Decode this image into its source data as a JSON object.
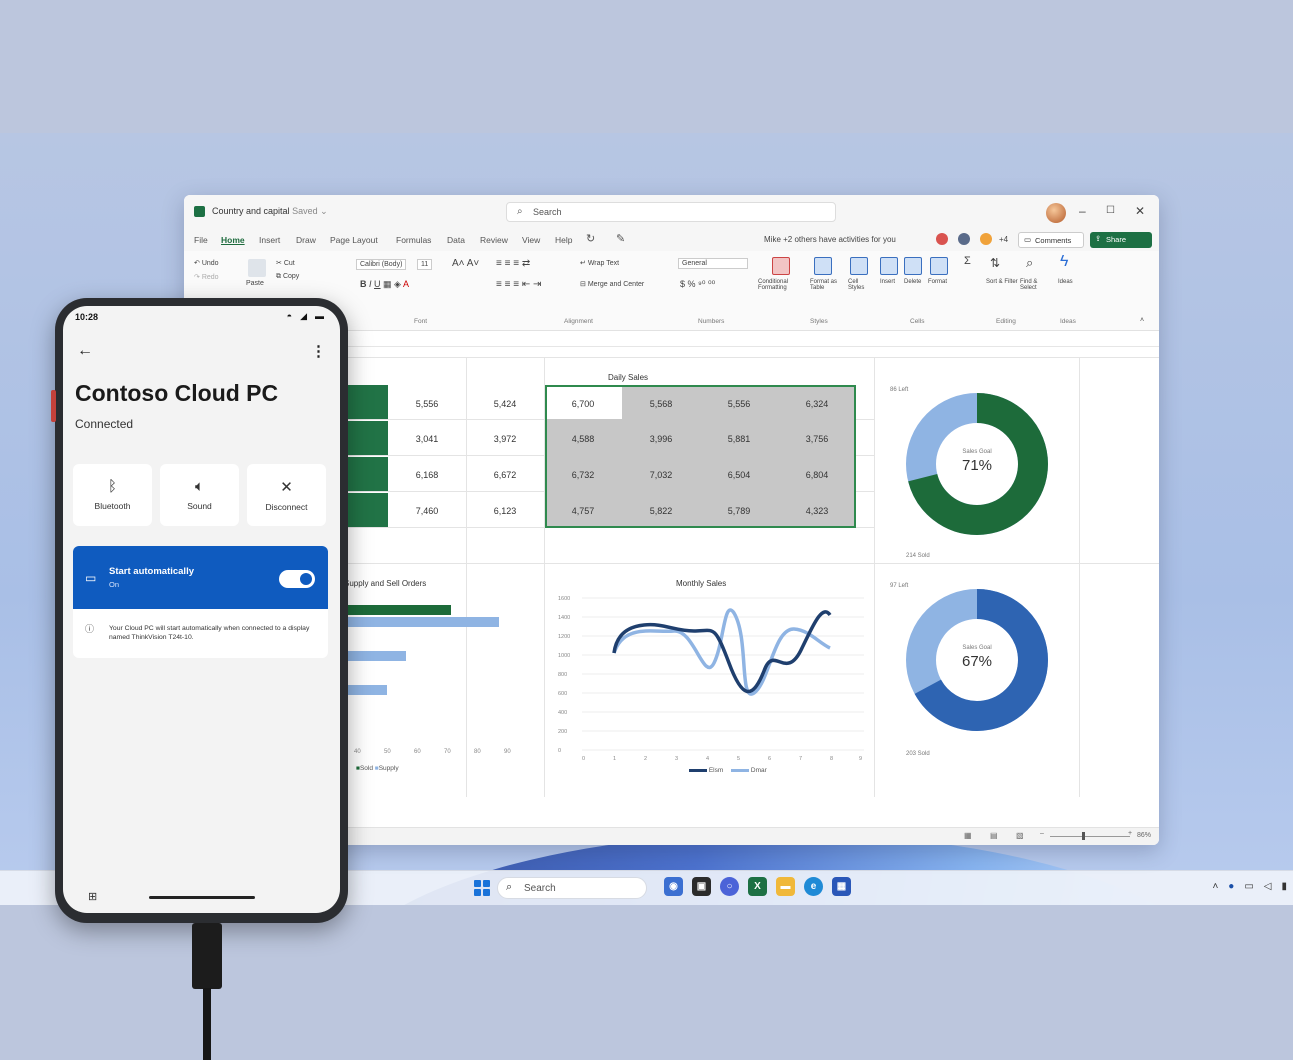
{
  "excel": {
    "doc_title": "Country and capital",
    "saved_label": "Saved",
    "search_placeholder": "Search",
    "menu_tabs": [
      "File",
      "Home",
      "Insert",
      "Draw",
      "Page Layout",
      "Formulas",
      "Data",
      "Review",
      "View",
      "Help"
    ],
    "collab_text": "Mike +2 others have activities for you",
    "collab_count": "+4",
    "comments_label": "Comments",
    "share_label": "Share",
    "ribbon": {
      "undo": "Undo",
      "redo": "Redo",
      "cut": "Cut",
      "copy": "Copy",
      "paste": "Paste",
      "font_name": "Calibri (Body)",
      "font_size": "11",
      "wrap_text": "Wrap Text",
      "merge_center": "Merge and Center",
      "number_format": "General",
      "conditional_formatting": "Conditional Formatting",
      "format_as_table": "Format as Table",
      "cell_styles": "Cell Styles",
      "insert": "Insert",
      "delete": "Delete",
      "format": "Format",
      "sort_filter": "Sort & Filter",
      "find_select": "Find & Select",
      "ideas": "Ideas",
      "groups": [
        "Font",
        "Alignment",
        "Numbers",
        "Styles",
        "Cells",
        "Editing",
        "Ideas"
      ]
    },
    "daily_sales_title": "Daily Sales",
    "left_values": [
      [
        "5,556",
        "5,424"
      ],
      [
        "3,041",
        "3,972"
      ],
      [
        "6,168",
        "6,672"
      ],
      [
        "7,460",
        "6,123"
      ]
    ],
    "selected_values": [
      [
        "6,700",
        "5,568",
        "5,556",
        "6,324"
      ],
      [
        "4,588",
        "3,996",
        "5,881",
        "3,756"
      ],
      [
        "6,732",
        "7,032",
        "6,504",
        "6,804"
      ],
      [
        "4,757",
        "5,822",
        "5,789",
        "4,323"
      ]
    ],
    "bar_chart_title": "Supply and Sell Orders",
    "bar_legend": [
      "Sold",
      "Supply"
    ],
    "monthly_sales_title": "Monthly Sales",
    "line_legend": [
      "Elsm",
      "Dmar"
    ],
    "donut1": {
      "center_label": "Sales Goal",
      "percent": "71%",
      "value": 0.71,
      "top_label": "86 Left",
      "bottom_label": "214 Sold"
    },
    "donut2": {
      "center_label": "Sales Goal",
      "percent": "67%",
      "value": 0.67,
      "top_label": "97 Left",
      "bottom_label": "203 Sold"
    },
    "zoom": "86%",
    "colors": {
      "excel_green": "#217346",
      "dark_blue": "#1f3f6e",
      "light_blue": "#8fb4e3",
      "donut2_blue": "#2e64b2"
    }
  },
  "taskbar": {
    "search_label": "Search"
  },
  "phone": {
    "time": "10:28",
    "title": "Contoso Cloud PC",
    "status": "Connected",
    "actions": [
      {
        "label": "Bluetooth",
        "icon": "bluetooth-icon"
      },
      {
        "label": "Sound",
        "icon": "speaker-icon"
      },
      {
        "label": "Disconnect",
        "icon": "close-icon"
      }
    ],
    "auto_start": {
      "title": "Start automatically",
      "state": "On",
      "info": "Your Cloud PC will start automatically when connected to a display named ThinkVision T24t-10."
    },
    "accent": "#0f5bbf"
  }
}
